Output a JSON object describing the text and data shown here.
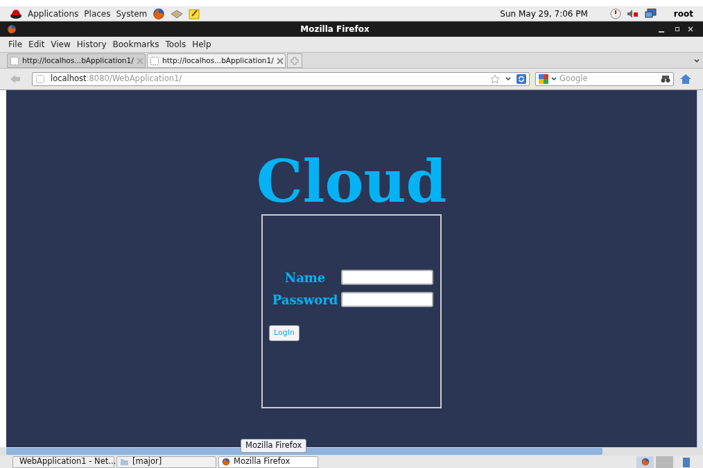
{
  "top_panel": {
    "menus": [
      "Applications",
      "Places",
      "System"
    ],
    "clock": "Sun May 29,  7:06 PM",
    "user": "root"
  },
  "window": {
    "title": "Mozilla Firefox"
  },
  "menubar": [
    "File",
    "Edit",
    "View",
    "History",
    "Bookmarks",
    "Tools",
    "Help"
  ],
  "tabs": [
    {
      "label": "http://localhos...bApplication1/",
      "selected": false
    },
    {
      "label": "http://localhos...bApplication1/",
      "selected": true
    }
  ],
  "address": {
    "host": "localhost",
    "rest": ":8080/WebApplication1/"
  },
  "search": {
    "placeholder": "Google"
  },
  "page": {
    "heading": "Cloud",
    "fields": [
      {
        "label": "Name"
      },
      {
        "label": "Password"
      }
    ],
    "button": "LogIn"
  },
  "tooltip": "Mozilla Firefox",
  "taskbar": [
    {
      "label": "WebApplication1 - Net...",
      "selected": false,
      "kind": "app"
    },
    {
      "label": "[major]",
      "selected": false,
      "kind": "folder"
    },
    {
      "label": "Mozilla Firefox",
      "selected": true,
      "kind": "browser"
    }
  ]
}
